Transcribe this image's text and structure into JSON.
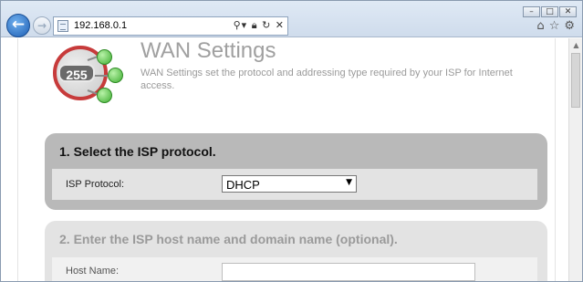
{
  "browser": {
    "address": "192.168.0.1",
    "address_icons": [
      "search-dropdown",
      "lock",
      "refresh",
      "close"
    ],
    "window_controls": [
      "minimize",
      "maximize",
      "close"
    ],
    "toolbar_icons": [
      "home",
      "favorites-star",
      "settings-gear"
    ]
  },
  "header": {
    "logo_text": "255",
    "title": "WAN Settings",
    "description": "WAN Settings set the protocol and addressing type required by your ISP for Internet access."
  },
  "section1": {
    "heading": "1. Select the ISP protocol.",
    "field_label": "ISP Protocol:",
    "selected_value": "DHCP"
  },
  "section2": {
    "heading": "2. Enter the ISP host name and domain name (optional).",
    "field_label": "Host Name:",
    "field_value": ""
  },
  "colors": {
    "section1_bg": "#b9b9b9",
    "section2_bg": "#e3e3e3",
    "logo_ring": "#c73b3b",
    "logo_nodes": "#3fae32"
  }
}
